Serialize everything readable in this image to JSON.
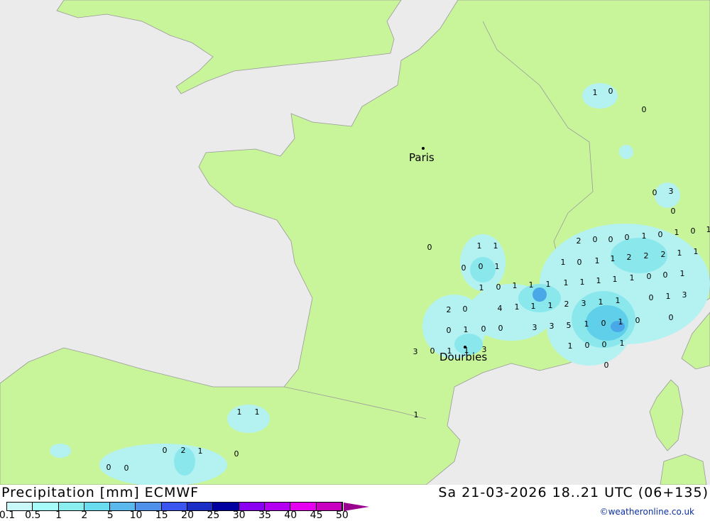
{
  "map": {
    "cities": [
      {
        "name": "Paris"
      },
      {
        "name": "Dourbies"
      }
    ],
    "colors": {
      "sea": "#ebebeb",
      "land": "#c8f59a",
      "border": "#a0a0a0",
      "light": "#b4f2f2",
      "mid": "#8ae8ec",
      "dark": "#5fcfea",
      "darker": "#4aa8e8"
    },
    "precip_values": [
      "1",
      "0",
      "0",
      "0",
      "3",
      "0",
      "2",
      "0",
      "0",
      "0",
      "1",
      "0",
      "1",
      "0",
      "1",
      "1",
      "0",
      "1",
      "1",
      "2",
      "2",
      "2",
      "1",
      "1",
      "0",
      "1",
      "1",
      "0",
      "0",
      "1",
      "1",
      "1",
      "1",
      "1",
      "0",
      "0",
      "1",
      "1",
      "0",
      "1",
      "1",
      "1",
      "1",
      "0",
      "1",
      "3",
      "4",
      "1",
      "1",
      "1",
      "2",
      "3",
      "1",
      "1",
      "2",
      "0",
      "0",
      "0",
      "1",
      "0",
      "0",
      "3",
      "3",
      "5",
      "1",
      "0",
      "1",
      "0",
      "3",
      "0",
      "1",
      "1",
      "3",
      "1",
      "0",
      "0",
      "1",
      "0",
      "1",
      "1",
      "1",
      "0",
      "2",
      "1",
      "0",
      "0",
      "0"
    ]
  },
  "footer": {
    "title": "Precipitation [mm] ECMWF",
    "datetime": "Sa 21-03-2026 18..21 UTC (06+135)",
    "copyright": "©weatheronline.co.uk",
    "legend": {
      "ticks": [
        "0.1",
        "0.5",
        "1",
        "2",
        "5",
        "10",
        "15",
        "20",
        "25",
        "30",
        "35",
        "40",
        "45",
        "50"
      ],
      "colors": [
        "#c8f8f8",
        "#a6fafa",
        "#8aeeee",
        "#6adcef",
        "#5ab8ec",
        "#4e90ea",
        "#3a55f0",
        "#1a2dc4",
        "#0000a0",
        "#8a00f0",
        "#b400f0",
        "#e600f0",
        "#c800c0"
      ]
    }
  }
}
